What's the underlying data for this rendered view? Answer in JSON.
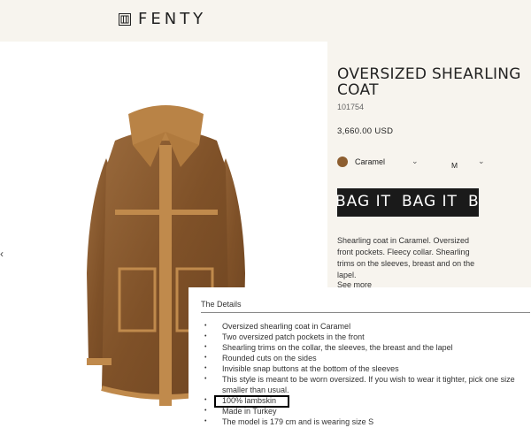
{
  "header": {
    "brand": "FENTY"
  },
  "product": {
    "title": "OVERSIZED SHEARLING COAT",
    "sku": "101754",
    "price": "3,660.00 USD",
    "color_label": "Caramel",
    "size_label": "M",
    "bag_button_label": "BAG IT",
    "description": "Shearling coat in Caramel. Oversized front pockets. Fleecy collar. Shearling trims on the sleeves, breast and on the lapel.",
    "see_more": "See more"
  },
  "details": {
    "title": "The Details",
    "items": [
      "Oversized shearling coat in Caramel",
      "Two oversized patch pockets in the front",
      "Shearling trims on the collar, the sleeves, the breast and the lapel",
      "Rounded cuts on the sides",
      "Invisible snap buttons at the bottom of the sleeves",
      "This style is meant to be worn oversized. If you wish to wear it tighter, pick one size smaller than usual.",
      "100% lambskin",
      "Made in Turkey",
      "The model is 179 cm and is wearing size S"
    ]
  },
  "colors": {
    "background": "#f7f4ee",
    "swatch": "#8d5e30",
    "button": "#1a1a1a",
    "coat": "#8a5a2e"
  }
}
